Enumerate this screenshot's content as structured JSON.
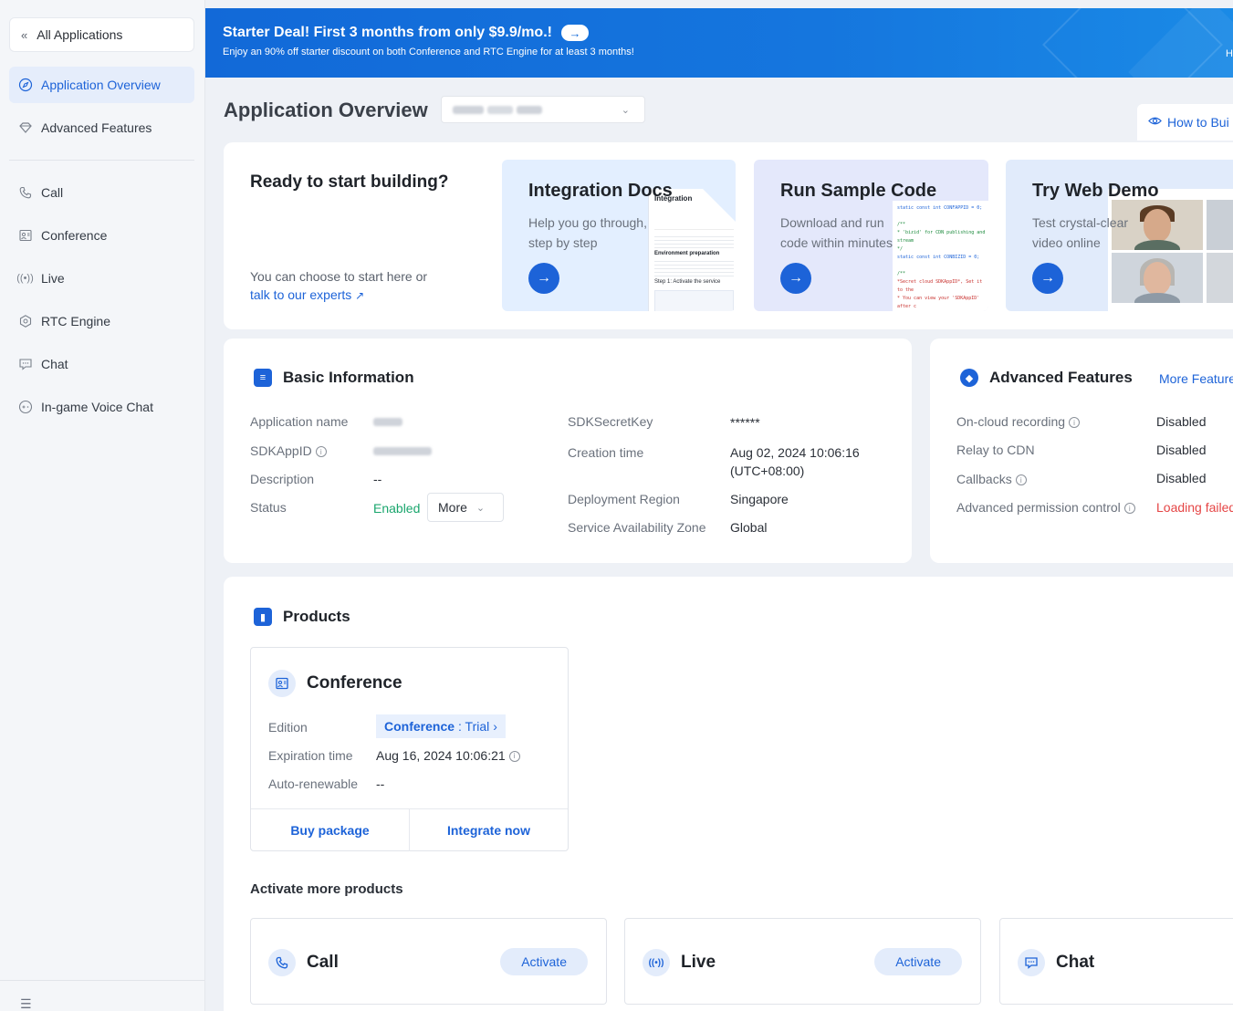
{
  "sidebar": {
    "back_label": "All Applications",
    "items": [
      {
        "label": "Application Overview",
        "icon": "compass-icon"
      },
      {
        "label": "Advanced Features",
        "icon": "diamond-icon"
      },
      {
        "label": "Call",
        "icon": "phone-icon"
      },
      {
        "label": "Conference",
        "icon": "conference-icon"
      },
      {
        "label": "Live",
        "icon": "live-icon"
      },
      {
        "label": "RTC Engine",
        "icon": "rtc-icon"
      },
      {
        "label": "Chat",
        "icon": "chat-icon"
      },
      {
        "label": "In-game Voice Chat",
        "icon": "gamepad-icon"
      }
    ]
  },
  "banner": {
    "title": "Starter Deal! First 3 months from only $9.9/mo.!",
    "subtitle": "Enjoy an 90% off starter discount on both Conference and RTC Engine for at least 3 months!",
    "edge_char": "H"
  },
  "header": {
    "title": "Application Overview",
    "how_to": "How to Bui"
  },
  "ready": {
    "title": "Ready to start building?",
    "hint": "You can choose to start here or",
    "link": "talk to our experts",
    "tiles": [
      {
        "title": "Integration Docs",
        "desc": "Help you go through, step by step"
      },
      {
        "title": "Run Sample Code",
        "desc": "Download and run code within minutes"
      },
      {
        "title": "Try Web Demo",
        "desc": "Test crystal-clear video online"
      }
    ],
    "doc_preview": {
      "heading": "Integration",
      "sub": "Environment preparation",
      "step": "Step 1: Activate the service"
    },
    "code_preview": {
      "line1": "static const int CONFAPPID = 0;",
      "line2": "* 'bizid' for CDN publishing and stream",
      "line3": "static const int CONBIZID = 0;",
      "line4": "*Secret cloud SDKAppID*, Set it to the",
      "line5": "* You can view your 'SDKAppID' after c"
    }
  },
  "basic": {
    "title": "Basic Information",
    "left": [
      {
        "label": "Application name"
      },
      {
        "label": "SDKAppID"
      },
      {
        "label": "Description",
        "value": "--"
      },
      {
        "label": "Status",
        "value": "Enabled"
      }
    ],
    "more_label": "More",
    "right": [
      {
        "label": "SDKSecretKey",
        "value": "******"
      },
      {
        "label": "Creation time",
        "value": "Aug 02, 2024 10:06:16",
        "value2": "(UTC+08:00)"
      },
      {
        "label": "Deployment Region",
        "value": "Singapore"
      },
      {
        "label": "Service Availability Zone",
        "value": "Global"
      }
    ]
  },
  "advanced": {
    "title": "Advanced Features",
    "more_link": "More Feature",
    "rows": [
      {
        "label": "On-cloud recording",
        "value": "Disabled"
      },
      {
        "label": "Relay to CDN",
        "value": "Disabled"
      },
      {
        "label": "Callbacks",
        "value": "Disabled"
      },
      {
        "label": "Advanced permission control",
        "value": "Loading failed"
      }
    ]
  },
  "products": {
    "title": "Products",
    "conference": {
      "name": "Conference",
      "edition_label": "Edition",
      "edition_value": "Conference",
      "edition_tier": ": Trial",
      "expiration_label": "Expiration time",
      "expiration_value": "Aug 16, 2024 10:06:21",
      "auto_label": "Auto-renewable",
      "auto_value": "--",
      "buy": "Buy package",
      "integrate": "Integrate now"
    },
    "activate_title": "Activate more products",
    "more": [
      {
        "name": "Call",
        "action": "Activate"
      },
      {
        "name": "Live",
        "action": "Activate"
      },
      {
        "name": "Chat",
        "action": ""
      }
    ]
  },
  "colors": {
    "accent": "#1d63d8",
    "enabled": "#1aa66d",
    "error": "#e54545",
    "banner": "#1269d8"
  }
}
